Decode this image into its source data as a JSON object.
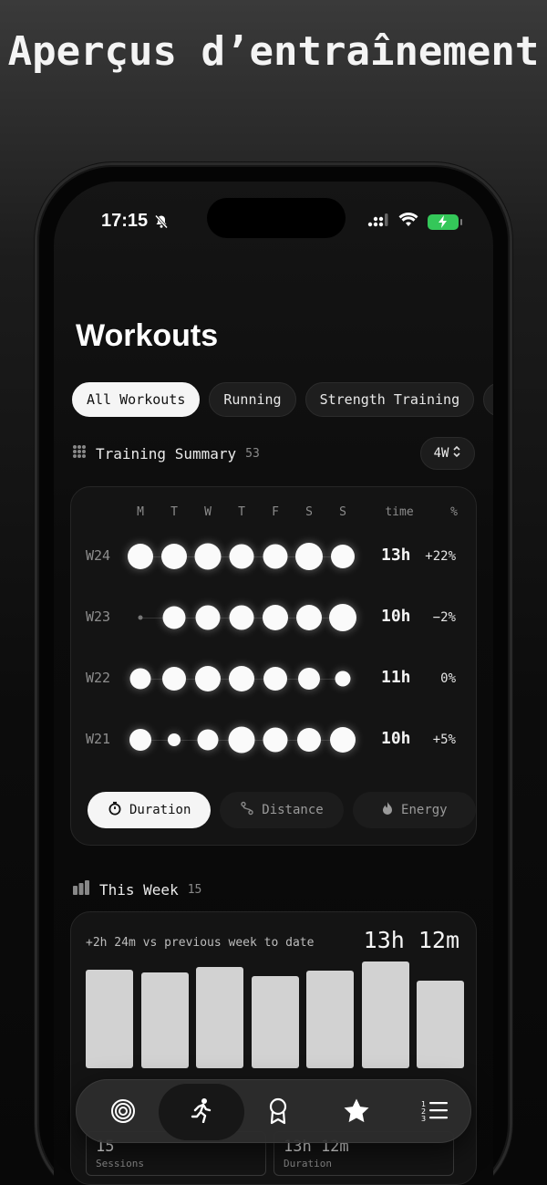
{
  "headline": "Aperçus d’entraînement",
  "status": {
    "time": "17:15"
  },
  "app": {
    "title": "Workouts"
  },
  "filters": [
    "All Workouts",
    "Running",
    "Strength Training"
  ],
  "summary": {
    "title": "Training Summary",
    "count": "53",
    "range": "4W",
    "days": [
      "M",
      "T",
      "W",
      "T",
      "F",
      "S",
      "S"
    ],
    "col_time": "time",
    "col_pct": "%",
    "weeks": [
      {
        "label": "W24",
        "time": "13h",
        "pct": "+22%",
        "sizes": [
          28,
          28,
          29,
          27,
          27,
          30,
          26
        ]
      },
      {
        "label": "W23",
        "time": "10h",
        "pct": "−2%",
        "sizes": [
          5,
          25,
          27,
          27,
          28,
          28,
          30
        ]
      },
      {
        "label": "W22",
        "time": "11h",
        "pct": "0%",
        "sizes": [
          23,
          26,
          28,
          28,
          26,
          24,
          17
        ]
      },
      {
        "label": "W21",
        "time": "10h",
        "pct": "+5%",
        "sizes": [
          24,
          14,
          23,
          29,
          27,
          26,
          28
        ]
      }
    ],
    "metrics": [
      "Duration",
      "Distance",
      "Energy"
    ]
  },
  "this_week": {
    "title": "This Week",
    "count": "15",
    "note": "+2h 24m vs previous week to date",
    "total": "13h 12m",
    "bars": [
      0.72,
      0.7,
      0.74,
      0.67,
      0.71,
      0.78,
      0.64
    ],
    "stats": [
      {
        "value": "15",
        "label": "Sessions"
      },
      {
        "value": "13h 12m",
        "label": "Duration"
      }
    ]
  },
  "tabs": [
    "rings-icon",
    "running-icon",
    "award-icon",
    "star-icon",
    "list-icon"
  ]
}
